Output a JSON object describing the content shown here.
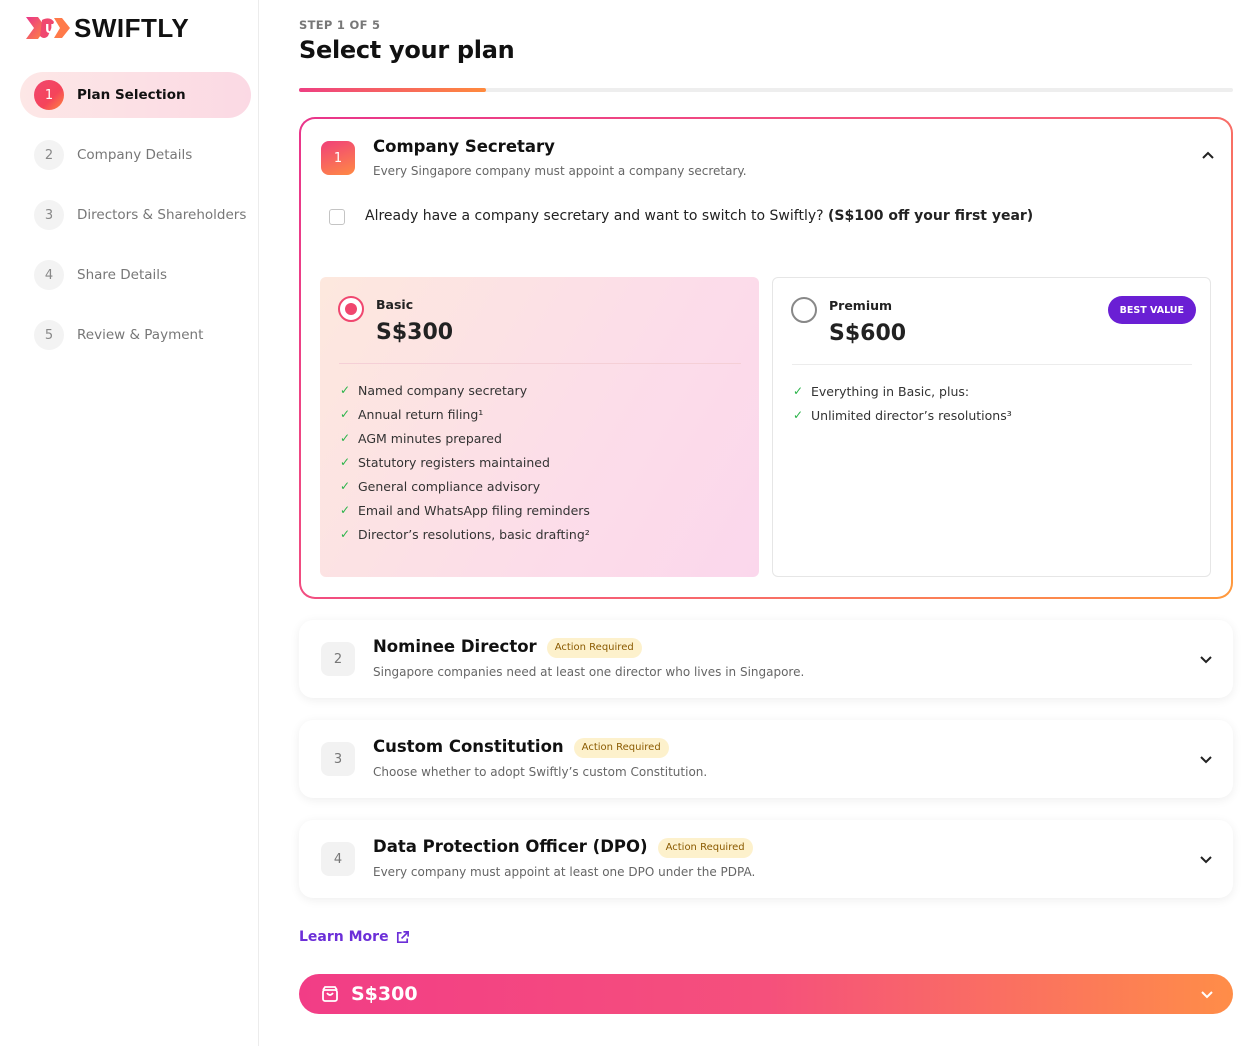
{
  "brand": {
    "name": "SWIFTLY"
  },
  "sidebar": {
    "steps": [
      {
        "num": "1",
        "label": "Plan Selection",
        "active": true
      },
      {
        "num": "2",
        "label": "Company Details"
      },
      {
        "num": "3",
        "label": "Directors & Shareholders"
      },
      {
        "num": "4",
        "label": "Share Details"
      },
      {
        "num": "5",
        "label": "Review & Payment"
      }
    ]
  },
  "header": {
    "step_caption": "STEP 1 OF 5",
    "title": "Select your plan",
    "progress": 0.2
  },
  "secretary": {
    "num": "1",
    "title": "Company Secretary",
    "subtitle": "Every Singapore company must appoint a company secretary.",
    "switch_text": "Already have a company secretary and want to switch to Swiftly?",
    "switch_offer": "(S$100 off your first year)",
    "plans": [
      {
        "name": "Basic",
        "price": "S$300",
        "selected": true,
        "features": [
          "Named company secretary",
          "Annual return filing¹",
          "AGM minutes prepared",
          "Statutory registers maintained",
          "General compliance advisory",
          "Email and WhatsApp filing reminders",
          "Director’s resolutions, basic drafting²"
        ]
      },
      {
        "name": "Premium",
        "price": "S$600",
        "badge": "BEST VALUE",
        "selected": false,
        "features": [
          "Everything in Basic, plus:",
          "Unlimited director’s resolutions³"
        ]
      }
    ]
  },
  "sections": [
    {
      "num": "2",
      "title": "Nominee Director",
      "tag": "Action Required",
      "subtitle": "Singapore companies need at least one director who lives in Singapore."
    },
    {
      "num": "3",
      "title": "Custom Constitution",
      "tag": "Action Required",
      "subtitle": "Choose whether to adopt Swiftly’s custom Constitution."
    },
    {
      "num": "4",
      "title": "Data Protection Officer (DPO)",
      "tag": "Action Required",
      "subtitle": "Every company must appoint at least one DPO under the PDPA."
    }
  ],
  "learn_more": "Learn More",
  "total": {
    "price": "S$300"
  },
  "colors": {
    "accent_pink": "#f0476f",
    "accent_orange": "#ff8a3d",
    "purple": "#6a1fd4",
    "check_green": "#2bb44a"
  }
}
